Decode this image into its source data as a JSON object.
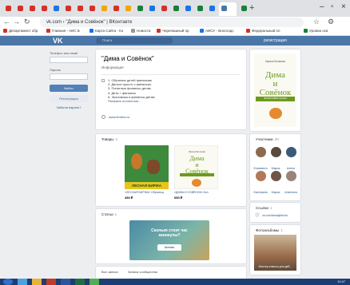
{
  "browser": {
    "active_tab_title": "\"Дима и Совёнок\" | ВКонтакте",
    "url": "vk.com › \"Дима и Совёнок\" | ВКонтакте",
    "tab_colors": [
      "#d93025",
      "#d93025",
      "#d93025",
      "#d93025",
      "#1a73e8",
      "#d93025",
      "#d93025",
      "#d93025",
      "#f2a600",
      "#d93025",
      "#f2a600",
      "#188038",
      "#1a73e8",
      "#d93025",
      "#188038",
      "#1a73e8",
      "#188038",
      "#1a73e8",
      "#4a76a8",
      "#188038"
    ],
    "new_tab": "+",
    "bookmarks": [
      "Департамент обр",
      "Главная - АИС Б",
      "Карта Сайта - Ко",
      "Новости",
      "Черепашный пр",
      "АИСУ - Вологодс",
      "Федеральный пл",
      "Уровни осв"
    ]
  },
  "vk": {
    "logo": "VK",
    "search_placeholder": "Поиск",
    "register_link": "регистрация"
  },
  "login": {
    "phone_label": "Телефон или email",
    "password_label": "Пароль",
    "login_button": "Войти",
    "register_button": "Регистрация",
    "forgot_link": "Забыли пароль?"
  },
  "group": {
    "title": "\"Дима и Совёнок\"",
    "section": "Информация",
    "list": [
      "1. Обучение детей финансам.",
      "2. Деньги просто о финансах.",
      "3. Понятные финансы детям.",
      "4. Дети + финансы",
      "5. Экономика и финансы детям"
    ],
    "show_more": "Показать полностью...",
    "website": "www.finotha.ru"
  },
  "goods": {
    "title": "Товары",
    "count": "2",
    "items": [
      {
        "name": "«ЛЕСНАЯ БИРЖА» Обучающ",
        "price": "450 ₽",
        "band": "ЛЕСНАЯ БИРЖА"
      },
      {
        "name": "«ДИМА И СОВЁНОК» Кол",
        "price": "650 ₽",
        "author": "Ирина Волкова",
        "title1": "Дима",
        "title2": "и",
        "title3": "Совёнок"
      }
    ]
  },
  "articles": {
    "title": "Статьи",
    "count": "1",
    "card_text_1": "Сколько стоит час",
    "card_text_2": "каникулы?",
    "read_button": "Читать"
  },
  "wall": {
    "tabs": [
      "Все записи",
      "Записи сообщества"
    ]
  },
  "cover": {
    "author": "Ирина Волкова",
    "title1": "Дима",
    "title2": "и",
    "title3": "Совёнок",
    "band": "ФИНАНСОВЫЕ СКАЗКИ"
  },
  "members": {
    "title": "Участники",
    "count": "2Н",
    "list": [
      {
        "name": "Елизавета",
        "color": "#8c6a4f"
      },
      {
        "name": "Мария",
        "color": "#5a4a3e"
      },
      {
        "name": "Алена",
        "color": "#3c5a78"
      },
      {
        "name": "Екатерина",
        "color": "#b07a5a"
      },
      {
        "name": "Мария",
        "color": "#6e5548"
      },
      {
        "name": "Алевтина",
        "color": "#9a8478"
      }
    ]
  },
  "links": {
    "title": "Ссылки",
    "count": "1",
    "item": "vk.com/taimajbkfcha"
  },
  "photos": {
    "title": "Фотоальбомы",
    "count": "1",
    "album": "Мастер-классы для деб..."
  },
  "taskbar": {
    "clock": "11:47"
  }
}
